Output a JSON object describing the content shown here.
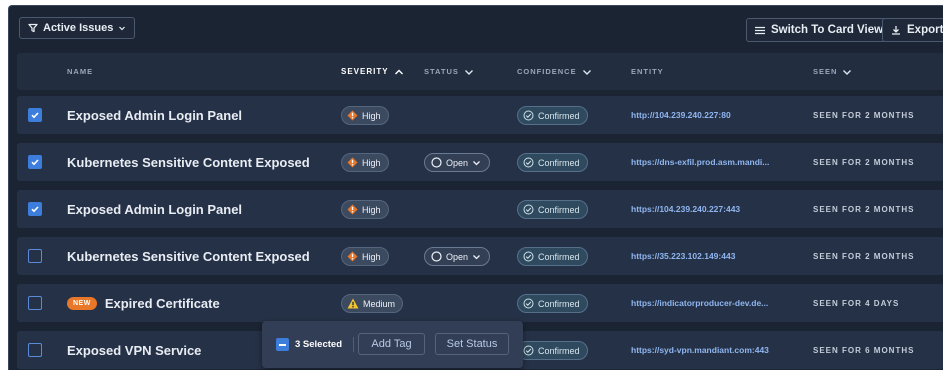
{
  "toolbar": {
    "filter_label": "Active Issues",
    "card_view_label": "Switch To Card View",
    "export_label": "Export"
  },
  "columns": {
    "name": "NAME",
    "severity": "SEVERITY",
    "status": "STATUS",
    "confidence": "CONFIDENCE",
    "entity": "ENTITY",
    "seen": "SEEN"
  },
  "rows": [
    {
      "checked": true,
      "is_new": false,
      "name": "Exposed Admin Login Panel",
      "severity": "High",
      "status": "",
      "confidence": "Confirmed",
      "entity": "http://104.239.240.227:80",
      "seen": "SEEN FOR 2 MONTHS"
    },
    {
      "checked": true,
      "is_new": false,
      "name": "Kubernetes Sensitive Content Exposed",
      "severity": "High",
      "status": "Open",
      "confidence": "Confirmed",
      "entity": "https://dns-exfil.prod.asm.mandi...",
      "seen": "SEEN FOR 2 MONTHS"
    },
    {
      "checked": true,
      "is_new": false,
      "name": "Exposed Admin Login Panel",
      "severity": "High",
      "status": "",
      "confidence": "Confirmed",
      "entity": "https://104.239.240.227:443",
      "seen": "SEEN FOR 2 MONTHS"
    },
    {
      "checked": false,
      "is_new": false,
      "name": "Kubernetes Sensitive Content Exposed",
      "severity": "High",
      "status": "Open",
      "confidence": "Confirmed",
      "entity": "https://35.223.102.149:443",
      "seen": "SEEN FOR 2 MONTHS"
    },
    {
      "checked": false,
      "is_new": true,
      "new_label": "NEW",
      "name": "Expired Certificate",
      "severity": "Medium",
      "status": "",
      "confidence": "Confirmed",
      "entity": "https://indicatorproducer-dev.de...",
      "seen": "SEEN FOR 4 DAYS"
    },
    {
      "checked": false,
      "is_new": false,
      "name": "Exposed VPN Service",
      "severity": "",
      "status": "",
      "confidence": "Confirmed",
      "entity": "https://syd-vpn.mandiant.com:443",
      "seen": "SEEN FOR 6 MONTHS"
    }
  ],
  "selection_bar": {
    "count_label": "3 Selected",
    "add_tag_label": "Add Tag",
    "set_status_label": "Set Status"
  },
  "colors": {
    "background": "#1b2433",
    "row": "#253146",
    "accent_blue": "#3d7ddb",
    "high": "#e8772a",
    "medium": "#f2c230",
    "new_badge": "#e8772a",
    "link": "#8fb6f0"
  },
  "icons": {
    "filter": "funnel-icon",
    "card_view": "list-icon",
    "export": "download-icon",
    "high": "diamond-exclamation-icon",
    "medium": "triangle-warning-icon",
    "status": "circle-icon",
    "confirmed": "check-circle-icon"
  }
}
